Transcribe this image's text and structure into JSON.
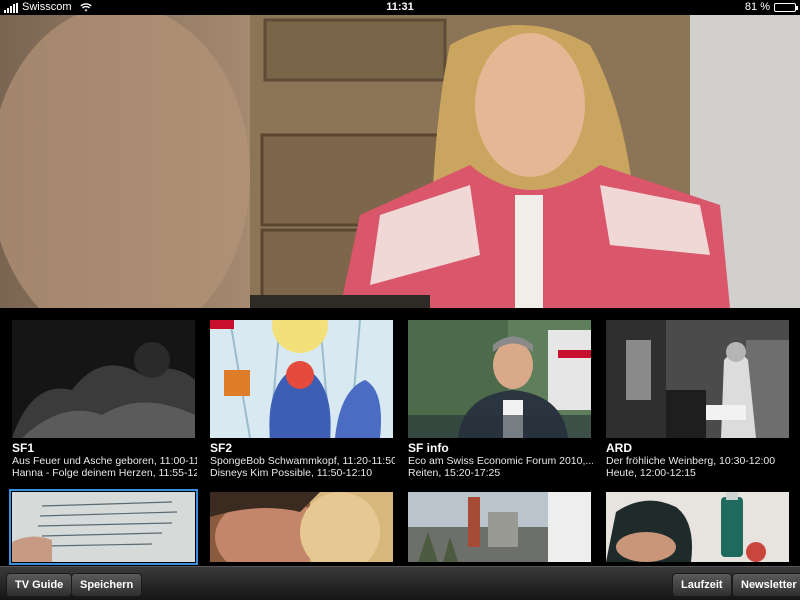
{
  "status_bar": {
    "carrier": "Swisscom",
    "time": "11:31",
    "battery": "81 %",
    "battery_level": 0.81
  },
  "channels": [
    {
      "name": "SF1",
      "programs": [
        "Aus Feuer und Asche geboren, 11:00-11...",
        "Hanna - Folge deinem Herzen, 11:55-12..."
      ]
    },
    {
      "name": "SF2",
      "programs": [
        "SpongeBob Schwammkopf, 11:20-11:50",
        "Disneys Kim Possible, 11:50-12:10"
      ]
    },
    {
      "name": "SF info",
      "programs": [
        "Eco am Swiss Economic Forum 2010,...",
        "Reiten, 15:20-17:25"
      ]
    },
    {
      "name": "ARD",
      "programs": [
        "Der fröhliche Weinberg, 10:30-12:00",
        "Heute, 12:00-12:15"
      ]
    }
  ],
  "toolbar": {
    "tv_guide": "TV Guide",
    "save": "Speichern",
    "runtime": "Laufzeit",
    "newsletter": "Newsletter"
  }
}
